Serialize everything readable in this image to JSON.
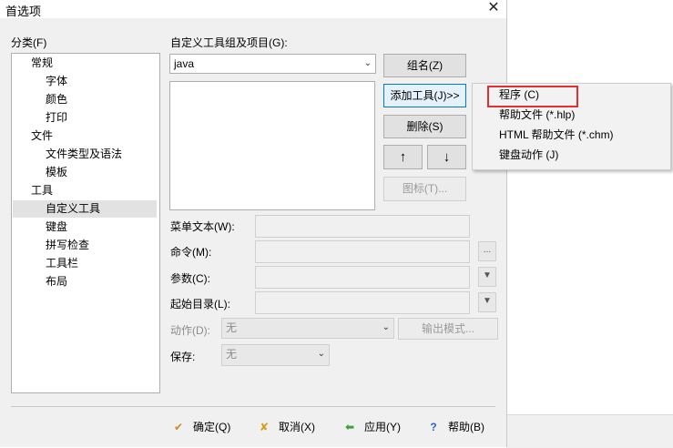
{
  "window": {
    "title": "首选项",
    "close_glyph": "✕"
  },
  "category": {
    "label": "分类(F)",
    "items": [
      {
        "label": "常规",
        "level": 0
      },
      {
        "label": "字体",
        "level": 1
      },
      {
        "label": "颜色",
        "level": 1
      },
      {
        "label": "打印",
        "level": 1
      },
      {
        "label": "文件",
        "level": 0
      },
      {
        "label": "文件类型及语法",
        "level": 1
      },
      {
        "label": "模板",
        "level": 1
      },
      {
        "label": "工具",
        "level": 0
      },
      {
        "label": "自定义工具",
        "level": 1,
        "selected": true
      },
      {
        "label": "键盘",
        "level": 1
      },
      {
        "label": "拼写检查",
        "level": 1
      },
      {
        "label": "工具栏",
        "level": 1
      },
      {
        "label": "布局",
        "level": 1
      }
    ]
  },
  "tools": {
    "group_label": "自定义工具组及项目(G):",
    "group_value": "java",
    "buttons": {
      "group_name": "组名(Z)",
      "add_tool": "添加工具(J)>>",
      "delete": "删除(S)",
      "up": "↑",
      "down": "↓",
      "icon": "图标(T)..."
    }
  },
  "fields": {
    "menu_text": "菜单文本(W):",
    "command": "命令(M):",
    "command_browse": "...",
    "args": "参数(C):",
    "start_dir": "起始目录(L):",
    "action_label": "动作(D):",
    "action_value": "无",
    "output_mode": "输出模式...",
    "save_label": "保存:",
    "save_value": "无"
  },
  "add_menu": {
    "items": [
      "程序 (C)",
      "帮助文件 (*.hlp)",
      "HTML 帮助文件 (*.chm)",
      "键盘动作 (J)"
    ],
    "highlight_color": "#e03030"
  },
  "footer": {
    "ok": "确定(Q)",
    "cancel": "取消(X)",
    "apply": "应用(Y)",
    "help": "帮助(B)"
  }
}
